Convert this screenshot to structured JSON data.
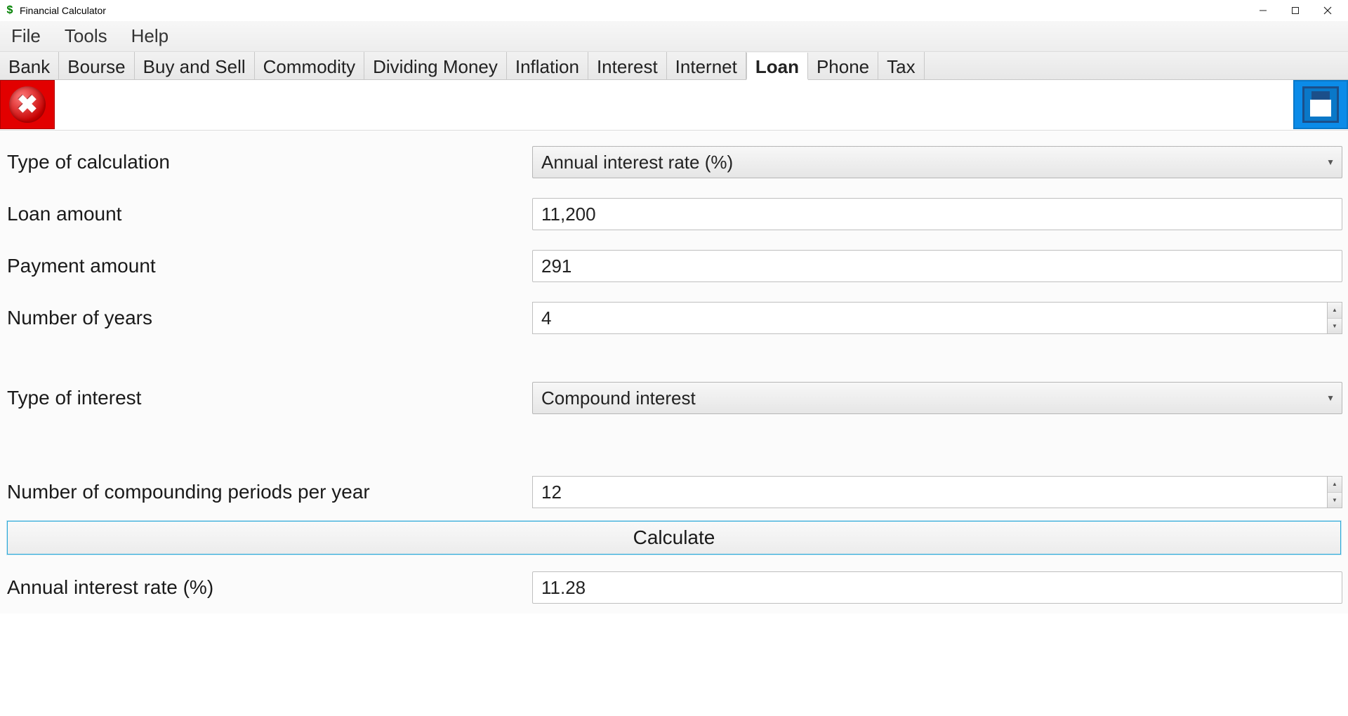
{
  "title": "Financial Calculator",
  "menu": {
    "file": "File",
    "tools": "Tools",
    "help": "Help"
  },
  "tabs": {
    "bank": "Bank",
    "bourse": "Bourse",
    "buy_sell": "Buy and Sell",
    "commodity": "Commodity",
    "dividing_money": "Dividing Money",
    "inflation": "Inflation",
    "interest": "Interest",
    "internet": "Internet",
    "loan": "Loan",
    "phone": "Phone",
    "tax": "Tax"
  },
  "labels": {
    "type_of_calculation": "Type of calculation",
    "loan_amount": "Loan amount",
    "payment_amount": "Payment amount",
    "number_of_years": "Number of years",
    "type_of_interest": "Type of interest",
    "compounding_periods": "Number of compounding periods per year",
    "calculate": "Calculate",
    "annual_interest_rate": "Annual interest rate (%)"
  },
  "values": {
    "type_of_calculation": "Annual interest rate (%)",
    "loan_amount": "11,200",
    "payment_amount": "291",
    "number_of_years": "4",
    "type_of_interest": "Compound interest",
    "compounding_periods": "12",
    "annual_interest_rate_result": "11.28"
  }
}
